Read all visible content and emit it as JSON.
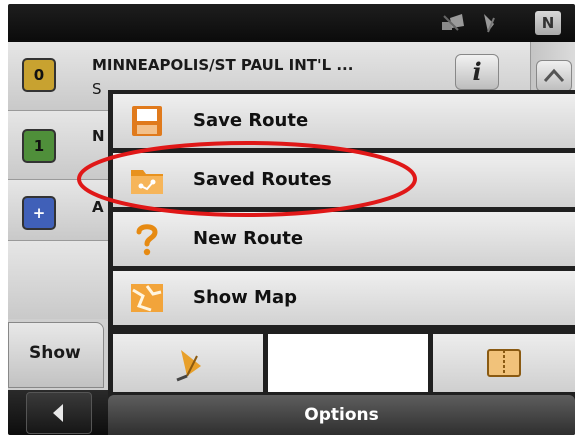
{
  "status_bar": {
    "compass_heading": "N",
    "icons": [
      "gps-signal-icon",
      "satellite-icon"
    ]
  },
  "background_list": {
    "rows": [
      {
        "number": "0",
        "line1": "MINNEAPOLIS/ST PAUL INT'L ...",
        "line2": "S",
        "badge_color": "#c8a230"
      },
      {
        "number": "1",
        "line1": "N",
        "line2": "",
        "badge_color": "#4f8f3a"
      },
      {
        "number": "+",
        "line1": "A",
        "line2": "",
        "badge_color": "#4060b8"
      }
    ],
    "show_tab_label": "Show"
  },
  "menu": {
    "items": [
      {
        "label": "Save Route",
        "icon": "save-route-icon"
      },
      {
        "label": "Saved Routes",
        "icon": "saved-routes-folder-icon"
      },
      {
        "label": "New Route",
        "icon": "question-mark-icon"
      },
      {
        "label": "Show Map",
        "icon": "map-icon"
      }
    ],
    "bottom_tiles": [
      "satellite-icon",
      "notebook-icon"
    ],
    "options_label": "Options"
  },
  "annotation": {
    "color": "#e01818",
    "target": "Saved Routes"
  }
}
